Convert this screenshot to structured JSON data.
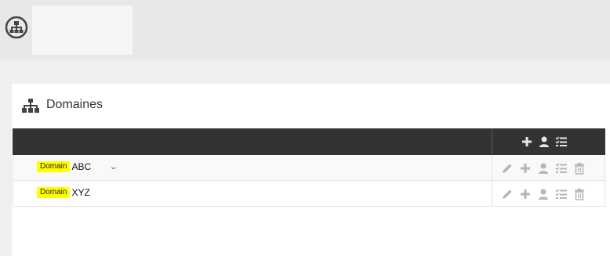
{
  "header": {
    "icon": "sitemap-circle-icon"
  },
  "panel": {
    "icon": "sitemap-icon",
    "title": "Domaines"
  },
  "table": {
    "header_actions": [
      "plus-icon",
      "user-icon",
      "checklist-icon"
    ],
    "rows": [
      {
        "tag": "Domain",
        "name": "ABC",
        "mark": "ᴗ",
        "actions": [
          "edit-icon",
          "plus-icon",
          "user-icon",
          "checklist-icon",
          "trash-icon"
        ]
      },
      {
        "tag": "Domain",
        "name": "XYZ",
        "mark": "",
        "actions": [
          "edit-icon",
          "plus-icon",
          "user-icon",
          "checklist-icon",
          "trash-icon"
        ]
      }
    ]
  },
  "colors": {
    "header_dark": "#333333",
    "highlight": "#ffff00",
    "icon_gray": "#b5b5b5",
    "icon_white": "#e6e6e6"
  }
}
